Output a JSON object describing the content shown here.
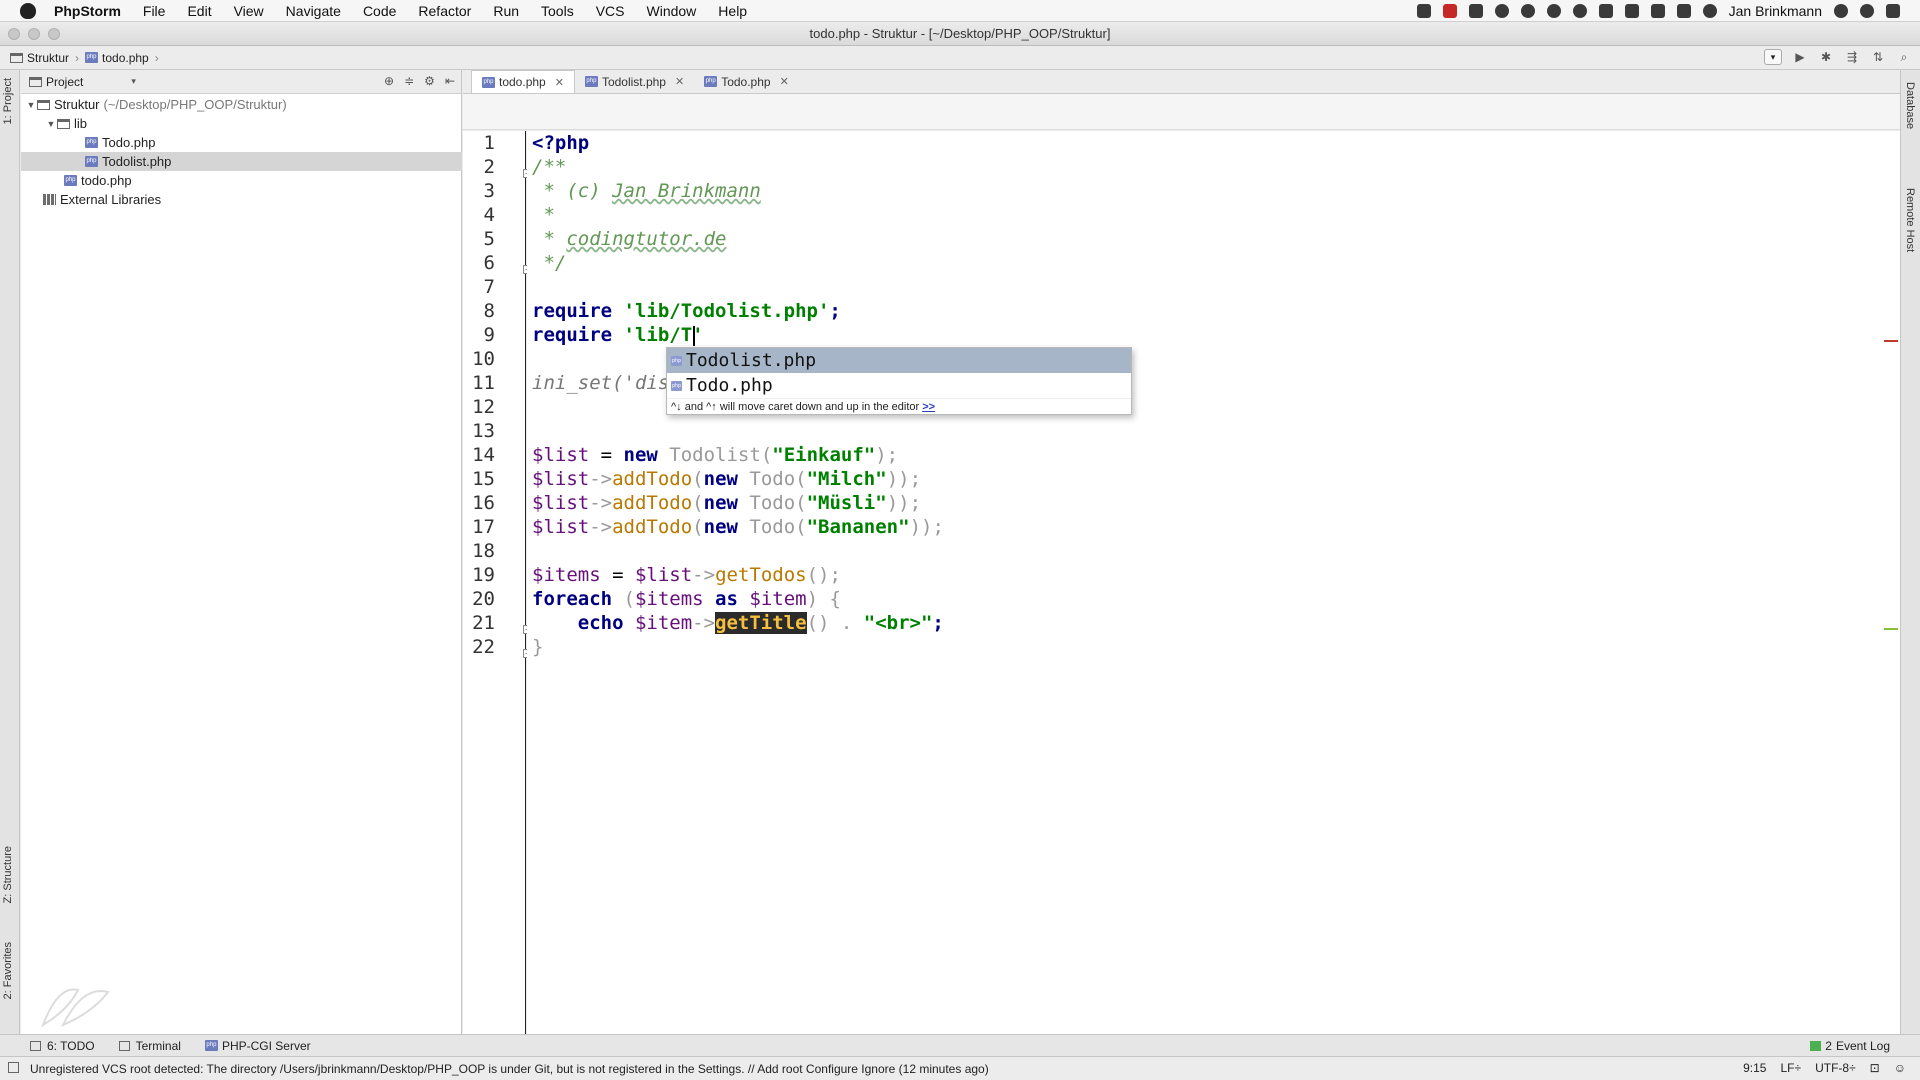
{
  "menubar": {
    "app": "PhpStorm",
    "items": [
      "File",
      "Edit",
      "View",
      "Navigate",
      "Code",
      "Refactor",
      "Run",
      "Tools",
      "VCS",
      "Window",
      "Help"
    ],
    "user": "Jan Brinkmann"
  },
  "window": {
    "title": "todo.php - Struktur - [~/Desktop/PHP_OOP/Struktur]"
  },
  "breadcrumb": {
    "project": "Struktur",
    "file": "todo.php"
  },
  "left_strip": {
    "project_tab": "1: Project",
    "structure_tab": "Z: Structure",
    "favorites_tab": "2: Favorites"
  },
  "right_strip": {
    "database_tab": "Database",
    "remote_tab": "Remote Host"
  },
  "project_panel": {
    "header": "Project",
    "tree": [
      {
        "label": "Struktur",
        "hint": "(~/Desktop/PHP_OOP/Struktur)"
      },
      {
        "label": "lib"
      },
      {
        "label": "Todo.php"
      },
      {
        "label": "Todolist.php"
      },
      {
        "label": "todo.php"
      },
      {
        "label": "External Libraries"
      }
    ]
  },
  "editor": {
    "tabs": [
      {
        "label": "todo.php",
        "active": true
      },
      {
        "label": "Todolist.php",
        "active": false
      },
      {
        "label": "Todo.php",
        "active": false
      }
    ],
    "line_numbers": [
      "1",
      "2",
      "3",
      "4",
      "5",
      "6",
      "7",
      "8",
      "9",
      "10",
      "11",
      "12",
      "13",
      "14",
      "15",
      "16",
      "17",
      "18",
      "19",
      "20",
      "21",
      "22"
    ],
    "code": {
      "l1": "<?php",
      "l2": "/**",
      "l3a": " * (c) ",
      "l3b": "Jan Brinkmann",
      "l4": " *",
      "l5a": " * ",
      "l5b": "codingtutor.de",
      "l6": " */",
      "l8a": "require ",
      "l8b": "'lib/Todolist.php'",
      "l8c": ";",
      "l9a": "require ",
      "l9b": "'lib/T'",
      "l11a": "ini_set",
      "l11b": "('dis",
      "l14_var": "$list",
      "l14_eq": " = ",
      "l14_new": "new ",
      "l14_cls": "Todolist",
      "l14_p1": "(",
      "l14_str": "\"Einkauf\"",
      "l14_p2": ");",
      "l15_var": "$list",
      "l15_arrow": "->",
      "l15_fn": "addTodo",
      "l15_p1": "(",
      "l15_new": "new ",
      "l15_cls": "Todo",
      "l15_p2": "(",
      "l15_str": "\"Milch\"",
      "l15_p3": "));",
      "l16_str": "\"Müsli\"",
      "l17_str": "\"Bananen\"",
      "l19_var": "$items",
      "l19_eq": " = ",
      "l19_var2": "$list",
      "l19_arrow": "->",
      "l19_fn": "getTodos",
      "l19_p": "();",
      "l20_kw": "foreach",
      "l20_p1": " (",
      "l20_var": "$items",
      "l20_as": " as ",
      "l20_var2": "$item",
      "l20_p2": ") {",
      "l21_echo": "    echo ",
      "l21_var": "$item",
      "l21_arrow": "->",
      "l21_fn": "getTitle",
      "l21_p": "() . ",
      "l21_str": "\"<br>\"",
      "l21_end": ";",
      "l22": "}"
    }
  },
  "completion": {
    "items": [
      {
        "label": "Todolist.php",
        "selected": true
      },
      {
        "label": "Todo.php",
        "selected": false
      }
    ],
    "hint": "^↓ and ^↑ will move caret down and up in the editor",
    "hint_link": ">>"
  },
  "bottom_bar": {
    "todo": "6: TODO",
    "terminal": "Terminal",
    "server": "PHP-CGI Server",
    "event_log": "Event Log",
    "event_count": "2"
  },
  "status": {
    "message": "Unregistered VCS root detected: The directory /Users/jbrinkmann/Desktop/PHP_OOP is under Git, but is not registered in the Settings. // Add root  Configure  Ignore (12 minutes ago)",
    "position": "9:15",
    "line_sep": "LF÷",
    "encoding": "UTF-8÷"
  },
  "colors": {
    "accent": "#a7b5c9",
    "keyword": "#000080",
    "string": "#008000",
    "highlight": "#f5c040"
  }
}
